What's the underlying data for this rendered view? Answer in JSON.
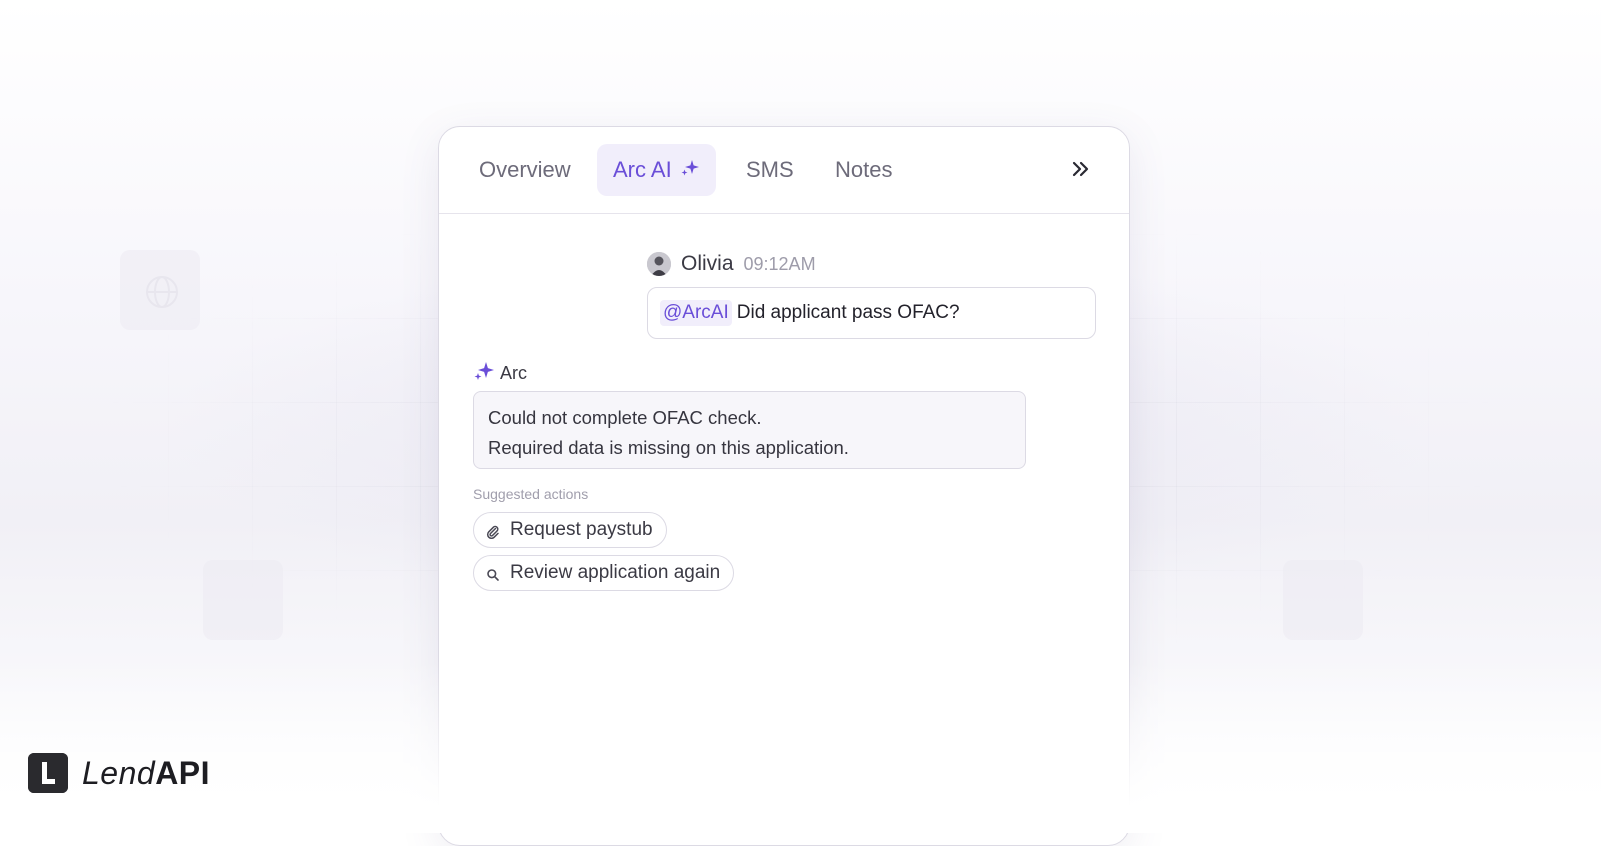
{
  "tabs": [
    {
      "label": "Overview",
      "active": false
    },
    {
      "label": "Arc AI",
      "active": true,
      "icon": "sparkle-icon"
    },
    {
      "label": "SMS",
      "active": false
    },
    {
      "label": "Notes",
      "active": false
    }
  ],
  "expand_icon": "double-chevron-right-icon",
  "user_message": {
    "author": "Olivia",
    "time": "09:12AM",
    "mention": "@ArcAI",
    "text": "Did applicant pass OFAC?"
  },
  "arc_message": {
    "author": "Arc",
    "lines": [
      "Could not complete OFAC check.",
      "Required data is missing on this application."
    ]
  },
  "suggested": {
    "label": "Suggested actions",
    "actions": [
      {
        "label": "Request paystub",
        "icon": "paperclip-icon"
      },
      {
        "label": "Review application again",
        "icon": "search-icon"
      }
    ]
  },
  "brand": {
    "name_light": "Lend",
    "name_bold": "API"
  },
  "colors": {
    "accent": "#6a4ed8",
    "accent_bg": "#f1eefb",
    "border": "#dcdae4"
  }
}
